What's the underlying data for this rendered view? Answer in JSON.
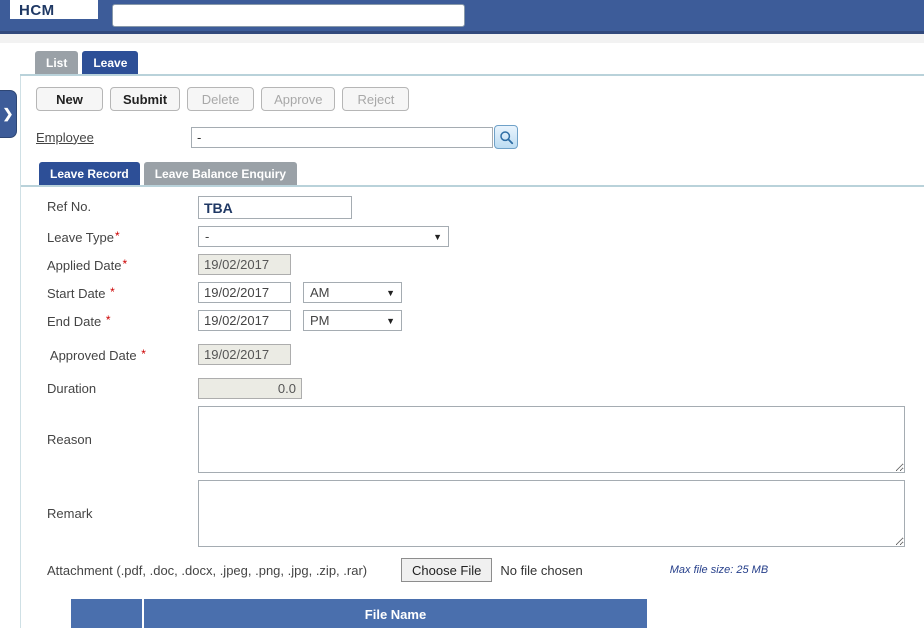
{
  "header": {
    "app_title": "HCM",
    "search_value": ""
  },
  "icons": {
    "sidebar_expand": "❯",
    "dropdown_arrow": "▼"
  },
  "misc": {
    "required_marker": "*"
  },
  "main_tabs": [
    {
      "label": "List",
      "active": false
    },
    {
      "label": "Leave",
      "active": true
    }
  ],
  "toolbar": {
    "buttons": [
      {
        "label": "New",
        "enabled": true
      },
      {
        "label": "Submit",
        "enabled": true
      },
      {
        "label": "Delete",
        "enabled": false
      },
      {
        "label": "Approve",
        "enabled": false
      },
      {
        "label": "Reject",
        "enabled": false
      }
    ]
  },
  "employee": {
    "label": "Employee",
    "value": "-"
  },
  "record_tabs": [
    {
      "label": "Leave Record",
      "active": true
    },
    {
      "label": "Leave Balance Enquiry",
      "active": false
    }
  ],
  "form": {
    "ref_no": {
      "label": "Ref No.",
      "value": "TBA"
    },
    "leave_type": {
      "label": "Leave Type",
      "required": true,
      "value": "-"
    },
    "applied_date": {
      "label": "Applied Date",
      "required": true,
      "value": "19/02/2017",
      "disabled": true
    },
    "start_date": {
      "label": "Start Date ",
      "required": true,
      "value": "19/02/2017",
      "period": "AM"
    },
    "end_date": {
      "label": "End Date ",
      "required": true,
      "value": "19/02/2017",
      "period": "PM"
    },
    "approved_date": {
      "label": " Approved Date ",
      "required": true,
      "value": "19/02/2017",
      "disabled": true
    },
    "duration": {
      "label": "Duration",
      "value": "0.0",
      "disabled": true
    },
    "reason": {
      "label": "Reason",
      "value": ""
    },
    "remark": {
      "label": "Remark",
      "value": ""
    },
    "attachment": {
      "label": "Attachment (.pdf, .doc, .docx, .jpeg, .png, .jpg, .zip, .rar)",
      "choose_file_label": "Choose File",
      "no_file_text": "No file chosen",
      "max_size_note": "Max file size: 25 MB"
    }
  },
  "file_table": {
    "columns": [
      "",
      "File Name"
    ]
  },
  "colors": {
    "header_blue": "#3d5c99",
    "active_tab_blue": "#2d4f97",
    "inactive_tab_gray": "#9aa1a7",
    "table_header_blue": "#4a6fad",
    "required_red": "#cc0000",
    "note_blue": "#27408b"
  }
}
